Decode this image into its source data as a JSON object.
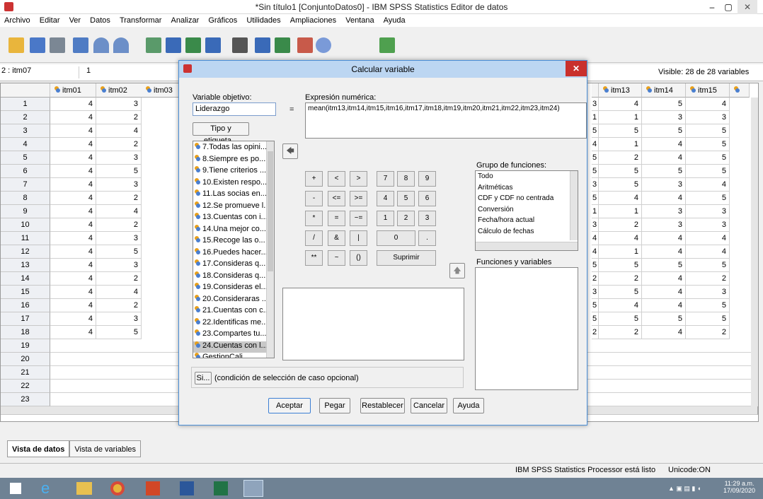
{
  "window": {
    "title": "*Sin título1 [ConjuntoDatos0] - IBM SPSS Statistics Editor de datos",
    "minimize": "–",
    "maximize": "▢",
    "close": "✕"
  },
  "menu": [
    "Archivo",
    "Editar",
    "Ver",
    "Datos",
    "Transformar",
    "Analizar",
    "Gráficos",
    "Utilidades",
    "Ampliaciones",
    "Ventana",
    "Ayuda"
  ],
  "cellref": {
    "name": "2 : itm07",
    "value": "1",
    "visible": "Visible: 28 de 28 variables"
  },
  "grid": {
    "left_cols": [
      "itm01",
      "itm02",
      "itm03"
    ],
    "right_cols": [
      "itm13",
      "itm14",
      "itm15"
    ],
    "rows": [
      "1",
      "2",
      "3",
      "4",
      "5",
      "6",
      "7",
      "8",
      "9",
      "10",
      "11",
      "12",
      "13",
      "14",
      "15",
      "16",
      "17",
      "18",
      "19",
      "20",
      "21",
      "22",
      "23"
    ],
    "left_data": [
      [
        "4",
        "3"
      ],
      [
        "4",
        "2"
      ],
      [
        "4",
        "4"
      ],
      [
        "4",
        "2"
      ],
      [
        "4",
        "3"
      ],
      [
        "4",
        "5"
      ],
      [
        "4",
        "3"
      ],
      [
        "4",
        "2"
      ],
      [
        "4",
        "4"
      ],
      [
        "4",
        "2"
      ],
      [
        "4",
        "3"
      ],
      [
        "4",
        "5"
      ],
      [
        "4",
        "3"
      ],
      [
        "4",
        "2"
      ],
      [
        "4",
        "4"
      ],
      [
        "4",
        "2"
      ],
      [
        "4",
        "3"
      ],
      [
        "4",
        "5"
      ]
    ],
    "partial": [
      "3",
      "1",
      "5",
      "4",
      "5",
      "5",
      "3",
      "5",
      "1",
      "3",
      "4",
      "4",
      "5",
      "2",
      "3",
      "5",
      "5",
      "2"
    ],
    "right_data": [
      [
        "4",
        "5",
        "4"
      ],
      [
        "1",
        "3",
        "3"
      ],
      [
        "5",
        "5",
        "5"
      ],
      [
        "1",
        "4",
        "5"
      ],
      [
        "2",
        "4",
        "5"
      ],
      [
        "5",
        "5",
        "5"
      ],
      [
        "5",
        "3",
        "4"
      ],
      [
        "4",
        "4",
        "5"
      ],
      [
        "1",
        "3",
        "3"
      ],
      [
        "2",
        "3",
        "3"
      ],
      [
        "4",
        "4",
        "4"
      ],
      [
        "1",
        "4",
        "4"
      ],
      [
        "5",
        "5",
        "5"
      ],
      [
        "2",
        "4",
        "2"
      ],
      [
        "5",
        "4",
        "3"
      ],
      [
        "4",
        "4",
        "5"
      ],
      [
        "5",
        "5",
        "5"
      ],
      [
        "2",
        "4",
        "2"
      ]
    ]
  },
  "tabs": {
    "data": "Vista de datos",
    "vars": "Vista de variables"
  },
  "status": {
    "processor": "IBM SPSS Statistics Processor está listo",
    "unicode": "Unicode:ON"
  },
  "taskbar": {
    "time": "11:29 a.m.",
    "date": "17/09/2020"
  },
  "dialog": {
    "title": "Calcular variable",
    "target_label": "Variable objetivo:",
    "target_value": "Liderazgo",
    "type_button": "Tipo y etiqueta...",
    "expr_label": "Expresión numérica:",
    "expr_value": "mean(itm13,itm14,itm15,itm16,itm17,itm18,itm19,itm20,itm21,itm22,itm23,itm24)",
    "equals": "=",
    "variables": [
      "7.Todas las opini...",
      "8.Siempre es po...",
      "9.Tiene criterios ...",
      "10.Existen respo...",
      "11.Las socias en...",
      "12.Se promueve l...",
      "13.Cuentas con i...",
      "14.Una mejor co...",
      "15.Recoge las o...",
      "16.Puedes hacer...",
      "17.Consideras q...",
      "18.Consideras q...",
      "19.Consideras el...",
      "20.Consideraras ...",
      "21.Cuentas con c...",
      "22.Identificas me...",
      "23.Compartes tu...",
      "24.Cuentas con l...",
      "GestionCali"
    ],
    "keypad": [
      [
        "+",
        "<",
        ">",
        "7",
        "8",
        "9"
      ],
      [
        "-",
        "<=",
        ">=",
        "4",
        "5",
        "6"
      ],
      [
        "*",
        "=",
        "~=",
        "1",
        "2",
        "3"
      ],
      [
        "/",
        "&",
        "|",
        "0",
        "."
      ],
      [
        "**",
        "~",
        "()",
        "Suprimir"
      ]
    ],
    "func_group_label": "Grupo de funciones:",
    "func_groups": [
      "Todo",
      "Aritméticas",
      "CDF y CDF no centrada",
      "Conversión",
      "Fecha/hora actual",
      "Cálculo de fechas"
    ],
    "special_label": "Funciones y variables especiales:",
    "if_button": "Si...",
    "if_text": "(condición de selección de caso opcional)",
    "buttons": {
      "ok": "Aceptar",
      "paste": "Pegar",
      "reset": "Restablecer",
      "cancel": "Cancelar",
      "help": "Ayuda"
    }
  }
}
